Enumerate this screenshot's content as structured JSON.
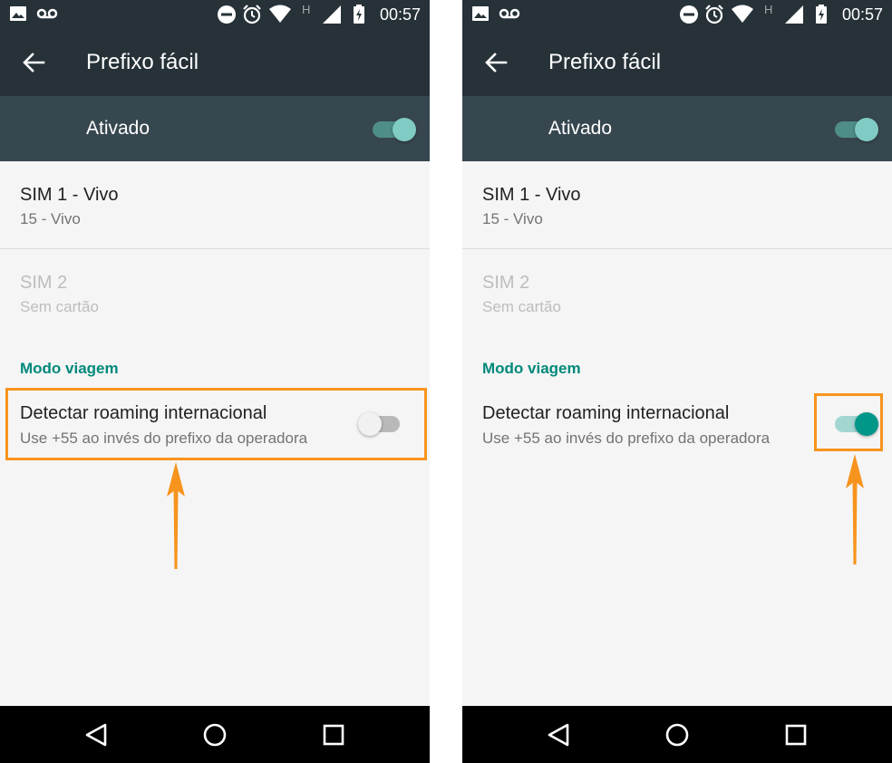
{
  "status_bar": {
    "time": "00:57",
    "network_label": "H",
    "icons": [
      "image-icon",
      "voicemail-icon",
      "do-not-disturb-icon",
      "alarm-icon",
      "wifi-icon",
      "signal-icon",
      "battery-charging-icon"
    ]
  },
  "colors": {
    "toolbar": "#263238",
    "master_bar": "#37474f",
    "accent": "#009688",
    "accent_light": "#80cbc4",
    "category": "#00897b",
    "highlight": "#f7941d",
    "background": "#f5f5f5",
    "nav_bar": "#000000"
  },
  "screens": [
    {
      "id": "before",
      "app_bar": {
        "title": "Prefixo fácil",
        "back_icon": "arrow-left-icon"
      },
      "master_switch": {
        "label": "Ativado",
        "on": true
      },
      "sim1": {
        "title": "SIM 1 - Vivo",
        "subtitle": "15 - Vivo",
        "enabled": true
      },
      "sim2": {
        "title": "SIM 2",
        "subtitle": "Sem cartão",
        "enabled": false
      },
      "category": "Modo viagem",
      "roaming": {
        "title": "Detectar roaming internacional",
        "subtitle": "Use +55 ao invés do prefixo da operadora",
        "on": false
      },
      "nav_icons": [
        "back-triangle-icon",
        "home-circle-icon",
        "recents-square-icon"
      ]
    },
    {
      "id": "after",
      "app_bar": {
        "title": "Prefixo fácil",
        "back_icon": "arrow-left-icon"
      },
      "master_switch": {
        "label": "Ativado",
        "on": true
      },
      "sim1": {
        "title": "SIM 1 - Vivo",
        "subtitle": "15 - Vivo",
        "enabled": true
      },
      "sim2": {
        "title": "SIM 2",
        "subtitle": "Sem cartão",
        "enabled": false
      },
      "category": "Modo viagem",
      "roaming": {
        "title": "Detectar roaming internacional",
        "subtitle": "Use +55 ao invés do prefixo da operadora",
        "on": true
      },
      "nav_icons": [
        "back-triangle-icon",
        "home-circle-icon",
        "recents-square-icon"
      ]
    }
  ]
}
